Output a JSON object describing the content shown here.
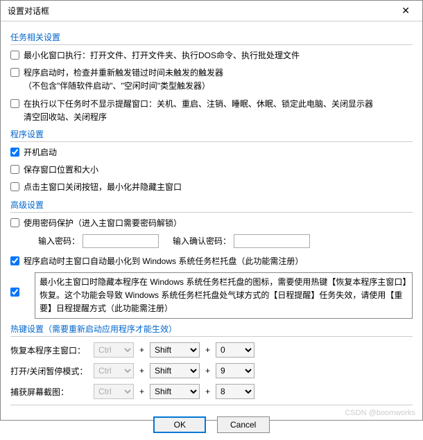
{
  "window": {
    "title": "设置对话框",
    "close_glyph": "✕"
  },
  "sections": {
    "task": {
      "header": "任务相关设置",
      "opt1": "最小化窗口执行：打开文件、打开文件夹、执行DOS命令、执行批处理文件",
      "opt2": "程序启动时，检查并重新触发错过时间未触发的触发器\n（不包含\"伴随软件启动\"、\"空闲时间\"类型触发器）",
      "opt3": "在执行以下任务时不显示提醒窗口：关机、重启、注销、睡眠、休眠、锁定此电脑、关闭显示器\n清空回收站、关闭程序"
    },
    "program": {
      "header": "程序设置",
      "opt1": "开机启动",
      "opt2": "保存窗口位置和大小",
      "opt3": "点击主窗口关闭按钮，最小化并隐藏主窗口"
    },
    "advanced": {
      "header": "高级设置",
      "pwd_opt": "使用密码保护（进入主窗口需要密码解锁）",
      "pwd_label1": "输入密码：",
      "pwd_label2": "输入确认密码：",
      "tray_opt": "程序启动时主窗口自动最小化到 Windows 系统任务栏托盘（此功能需注册）",
      "boxed_opt": "最小化主窗口时隐藏本程序在 Windows 系统任务栏托盘的图标，需要使用热键【恢复本程序主窗口】恢复。这个功能会导致 Windows 系统任务栏托盘处气球方式的【日程提醒】任务失效，请使用【重要】日程提醒方式（此功能需注册）"
    },
    "hotkey": {
      "header": "热键设置（需要重新启动应用程序才能生效）",
      "rows": [
        {
          "label": "恢复本程序主窗口：",
          "ctrl": "Ctrl",
          "mod": "Shift",
          "key": "0"
        },
        {
          "label": "打开/关闭暂停模式：",
          "ctrl": "Ctrl",
          "mod": "Shift",
          "key": "9"
        },
        {
          "label": "捕获屏幕截图：",
          "ctrl": "Ctrl",
          "mod": "Shift",
          "key": "8"
        }
      ],
      "plus": "+"
    }
  },
  "buttons": {
    "ok": "OK",
    "cancel": "Cancel"
  },
  "watermark": "CSDN @boomworks"
}
